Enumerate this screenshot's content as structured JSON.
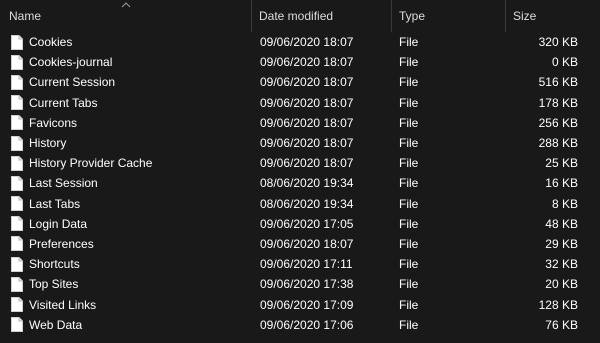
{
  "columns": {
    "name": "Name",
    "date": "Date modified",
    "type": "Type",
    "size": "Size"
  },
  "sort": {
    "column": "name",
    "direction": "ascending"
  },
  "files": [
    {
      "name": "Cookies",
      "date": "09/06/2020 18:07",
      "type": "File",
      "size": "320 KB"
    },
    {
      "name": "Cookies-journal",
      "date": "09/06/2020 18:07",
      "type": "File",
      "size": "0 KB"
    },
    {
      "name": "Current Session",
      "date": "09/06/2020 18:07",
      "type": "File",
      "size": "516 KB"
    },
    {
      "name": "Current Tabs",
      "date": "09/06/2020 18:07",
      "type": "File",
      "size": "178 KB"
    },
    {
      "name": "Favicons",
      "date": "09/06/2020 18:07",
      "type": "File",
      "size": "256 KB"
    },
    {
      "name": "History",
      "date": "09/06/2020 18:07",
      "type": "File",
      "size": "288 KB"
    },
    {
      "name": "History Provider Cache",
      "date": "09/06/2020 18:07",
      "type": "File",
      "size": "25 KB"
    },
    {
      "name": "Last Session",
      "date": "08/06/2020 19:34",
      "type": "File",
      "size": "16 KB"
    },
    {
      "name": "Last Tabs",
      "date": "08/06/2020 19:34",
      "type": "File",
      "size": "8 KB"
    },
    {
      "name": "Login Data",
      "date": "09/06/2020 17:05",
      "type": "File",
      "size": "48 KB"
    },
    {
      "name": "Preferences",
      "date": "09/06/2020 18:07",
      "type": "File",
      "size": "29 KB"
    },
    {
      "name": "Shortcuts",
      "date": "09/06/2020 17:11",
      "type": "File",
      "size": "32 KB"
    },
    {
      "name": "Top Sites",
      "date": "09/06/2020 17:38",
      "type": "File",
      "size": "20 KB"
    },
    {
      "name": "Visited Links",
      "date": "09/06/2020 17:09",
      "type": "File",
      "size": "128 KB"
    },
    {
      "name": "Web Data",
      "date": "09/06/2020 17:06",
      "type": "File",
      "size": "76 KB"
    }
  ]
}
